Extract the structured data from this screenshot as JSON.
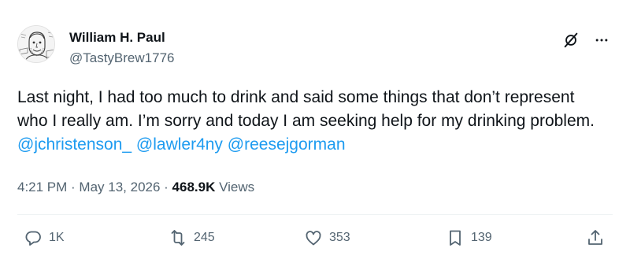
{
  "author": {
    "display_name": "William H. Paul",
    "handle": "@TastyBrew1776"
  },
  "tweet": {
    "text_parts": [
      "Last night, I had too much to drink and said some things that don’t represent who I really am. I’m sorry and today I am seeking help for my drinking problem. "
    ],
    "mentions": [
      "@jchristenson_",
      "@lawler4ny",
      "@reesejgorman"
    ]
  },
  "meta": {
    "time": "4:21 PM",
    "separator1": " · ",
    "date": "May 13, 2026",
    "separator2": " · ",
    "views_count": "468.9K",
    "views_label": " Views"
  },
  "actions": {
    "replies": "1K",
    "reposts": "245",
    "likes": "353",
    "bookmarks": "139"
  },
  "icons": {
    "avatar": "avatar-sketch",
    "grok": "grok-icon",
    "more": "more-icon",
    "reply": "reply-icon",
    "repost": "repost-icon",
    "like": "heart-icon",
    "bookmark": "bookmark-icon",
    "share": "share-icon"
  },
  "colors": {
    "text": "#0f1419",
    "secondary": "#536471",
    "link": "#1d9bf0"
  }
}
